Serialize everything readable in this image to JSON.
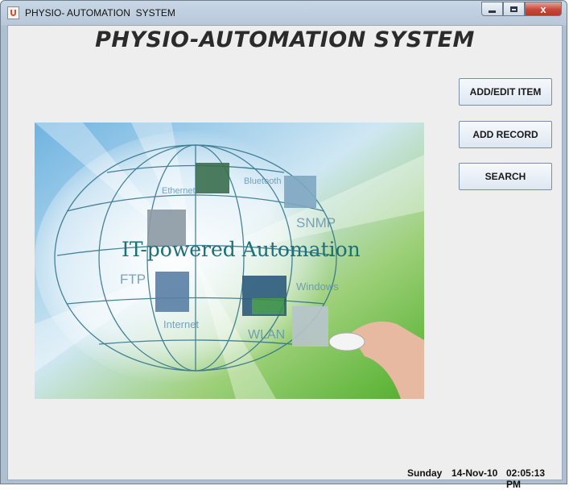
{
  "window": {
    "title": "PHYSIO- AUTOMATION  SYSTEM",
    "controls": {
      "close_label": "x"
    }
  },
  "header": {
    "title": "PHYSIO-AUTOMATION SYSTEM"
  },
  "banner": {
    "headline": "IT-powered  Automation",
    "tiles": [
      "Ethernet",
      "Bluetooth",
      "SNMP",
      "FTP",
      "Windows",
      "Internet",
      "WLAN"
    ]
  },
  "actions": {
    "add_edit_item": "ADD/EDIT ITEM",
    "add_record": "ADD RECORD",
    "search": "SEARCH"
  },
  "status_bar": {
    "day": "Sunday",
    "date": "14-Nov-10",
    "time": "02:05:13 PM"
  },
  "colors": {
    "button_border": "#7a8ea6",
    "banner_green": "#6cbf3a",
    "banner_blue": "#5aa3d6",
    "headline": "#1f6f78"
  }
}
